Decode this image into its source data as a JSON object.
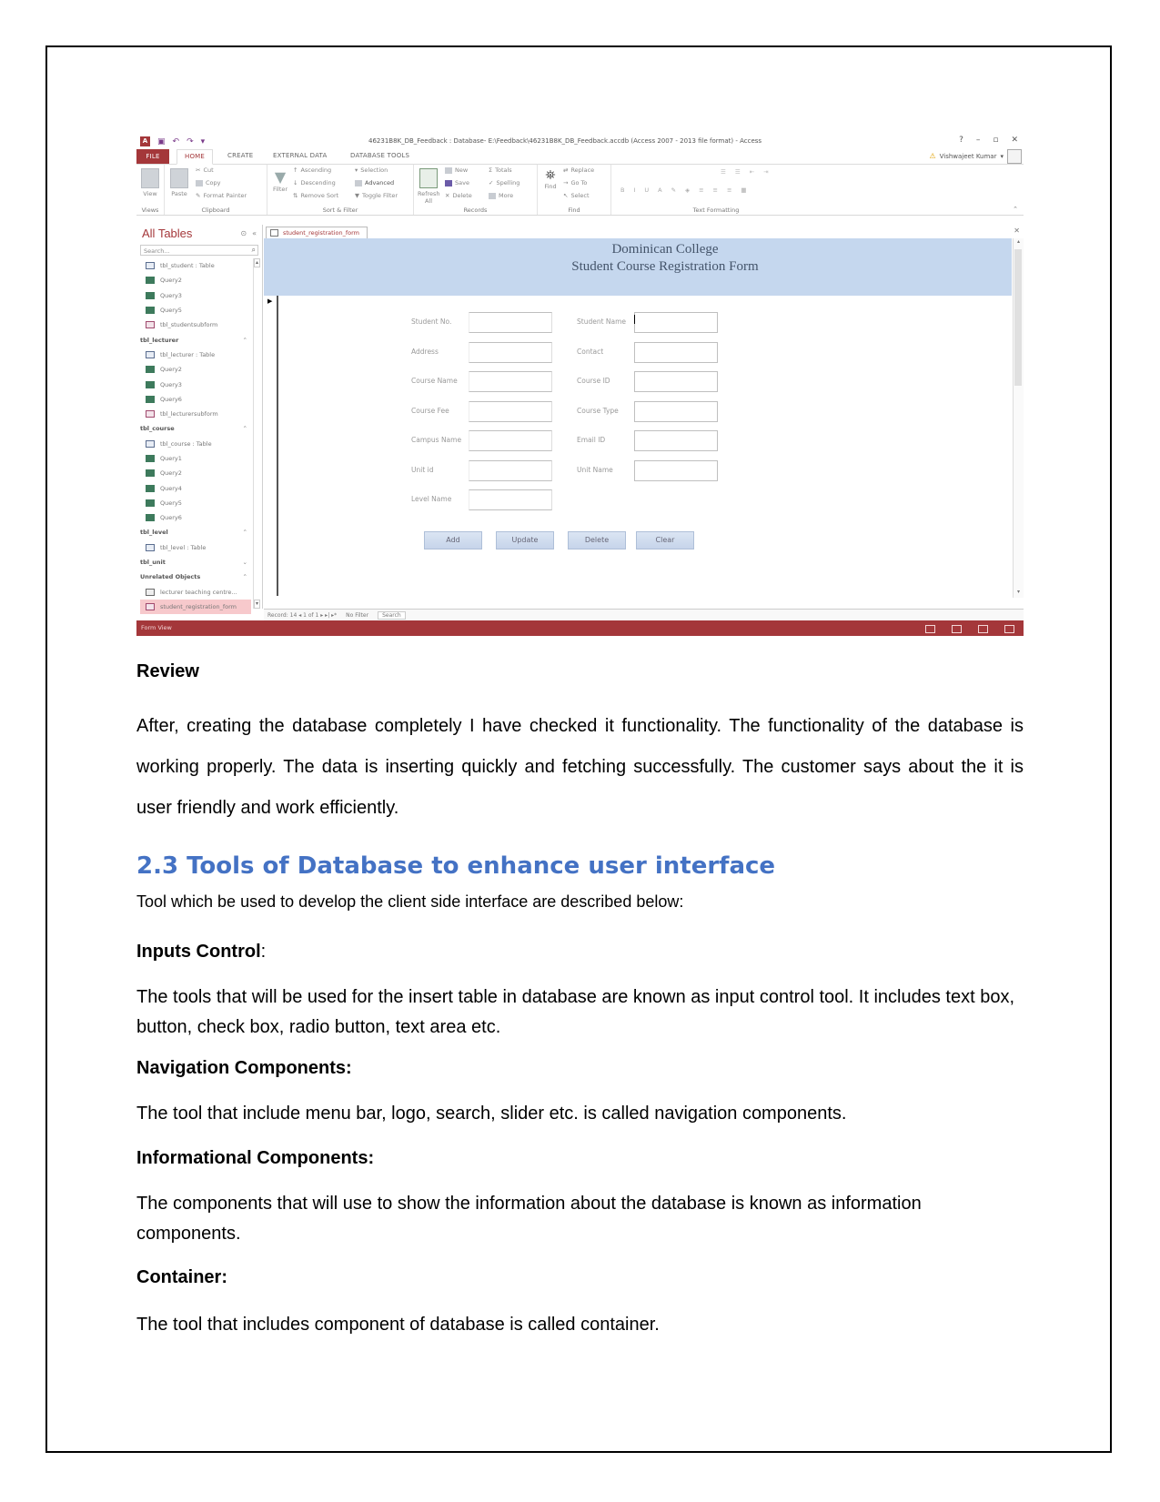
{
  "screenshot": {
    "title_bar": {
      "title": "46231B8K_DB_Feedback : Database- E:\\Feedback\\46231B8K_DB_Feedback.accdb (Access 2007 - 2013 file format) - Access",
      "help": "?",
      "minimize": "–",
      "maximize": "▫",
      "close": "✕"
    },
    "ribbon_tabs": [
      "FILE",
      "HOME",
      "CREATE",
      "EXTERNAL DATA",
      "DATABASE TOOLS"
    ],
    "user_name": "Vishwajeet Kumar",
    "ribbon_groups": {
      "views": {
        "label": "Views",
        "buttons": [
          "View"
        ]
      },
      "clipboard": {
        "label": "Clipboard",
        "buttons": [
          "Paste",
          "Cut",
          "Copy",
          "Format Painter"
        ]
      },
      "sort_filter": {
        "label": "Sort & Filter",
        "buttons": [
          "Filter",
          "Ascending",
          "Descending",
          "Remove Sort",
          "Selection",
          "Advanced",
          "Toggle Filter"
        ]
      },
      "records": {
        "label": "Records",
        "buttons": [
          "Refresh All",
          "New",
          "Save",
          "Delete",
          "Totals",
          "Spelling",
          "More"
        ]
      },
      "find": {
        "label": "Find",
        "buttons": [
          "Find",
          "Replace",
          "Go To",
          "Select"
        ]
      },
      "text_formatting": {
        "label": "Text Formatting",
        "buttons": [
          "B",
          "I",
          "U",
          "A"
        ]
      }
    },
    "nav_pane": {
      "title": "All Tables",
      "search_placeholder": "Search...",
      "items": [
        {
          "type": "table",
          "label": "tbl_student : Table"
        },
        {
          "type": "query",
          "label": "Query2"
        },
        {
          "type": "query",
          "label": "Query3"
        },
        {
          "type": "query",
          "label": "Query5"
        },
        {
          "type": "form",
          "label": "tbl_studentsubform"
        },
        {
          "type": "group",
          "label": "tbl_lecturer",
          "chevron": "⌃"
        },
        {
          "type": "table",
          "label": "tbl_lecturer : Table"
        },
        {
          "type": "query",
          "label": "Query2"
        },
        {
          "type": "query",
          "label": "Query3"
        },
        {
          "type": "query",
          "label": "Query6"
        },
        {
          "type": "form",
          "label": "tbl_lecturersubform"
        },
        {
          "type": "group",
          "label": "tbl_course",
          "chevron": "⌃"
        },
        {
          "type": "table",
          "label": "tbl_course : Table"
        },
        {
          "type": "query",
          "label": "Query1"
        },
        {
          "type": "query",
          "label": "Query2"
        },
        {
          "type": "query",
          "label": "Query4"
        },
        {
          "type": "query",
          "label": "Query5"
        },
        {
          "type": "query",
          "label": "Query6"
        },
        {
          "type": "group",
          "label": "tbl_level",
          "chevron": "⌃"
        },
        {
          "type": "table",
          "label": "tbl_level : Table"
        },
        {
          "type": "group",
          "label": "tbl_unit",
          "chevron": "⌄"
        },
        {
          "type": "group",
          "label": "Unrelated Objects",
          "chevron": "⌃"
        },
        {
          "type": "report",
          "label": "lecturer teaching centre..."
        },
        {
          "type": "form",
          "label": "student_registration_form",
          "selected": true
        }
      ]
    },
    "document_tab": "student_registration_form",
    "form": {
      "header_line1": "Dominican College",
      "header_line2": "Student Course Registration Form",
      "left_fields": [
        "Student No.",
        "Address",
        "Course Name",
        "Course Fee",
        "Campus Name",
        "Unit id",
        "Level Name"
      ],
      "right_fields": [
        "Student Name",
        "Contact",
        "Course ID",
        "Course Type",
        "Email ID",
        "Unit Name"
      ],
      "buttons": [
        "Add",
        "Update",
        "Delete",
        "Clear"
      ]
    },
    "record_nav": {
      "label": "Record: 14 ◂ 1 of 1 ▸ ▸| ▸*",
      "filter": "No Filter",
      "search": "Search"
    },
    "status_bar": {
      "label": "Form View"
    },
    "colors": {
      "access_accent": "#a4373a",
      "form_header": "#c5d7ee"
    }
  },
  "document": {
    "review_heading": "Review",
    "review_text": "After, creating the database completely I have checked it functionality. The functionality of the database is working properly. The data is inserting quickly and fetching successfully. The customer says about the it is user friendly and work efficiently.",
    "section_heading": "2.3 Tools of Database to enhance user interface",
    "section_intro": "Tool which be used to develop the client side interface are described below:",
    "subsections": [
      {
        "heading": "Inputs Control",
        "suffix": ":",
        "body": "The tools that will be used for the insert table in database are known as input control tool. It includes text box, button, check box, radio button, text area etc."
      },
      {
        "heading": "Navigation Components:",
        "suffix": "",
        "body": "The tool that include menu bar, logo, search, slider etc. is called navigation components."
      },
      {
        "heading": "Informational Components:",
        "suffix": "",
        "body": "The components that will use to show the information about the database is known as information components."
      },
      {
        "heading": "Container:",
        "suffix": "",
        "body": "The tool that includes component of database is called container."
      }
    ],
    "heading_color": "#4472c4"
  }
}
